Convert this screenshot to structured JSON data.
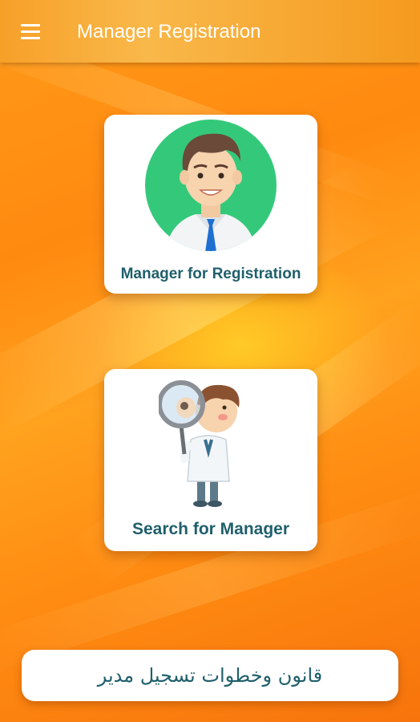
{
  "app_bar": {
    "title": "Manager Registration",
    "menu_icon": "hamburger-menu-icon"
  },
  "cards": {
    "register": {
      "label": "Manager for Registration",
      "image": "manager-avatar-icon"
    },
    "search": {
      "label": "Search for Manager",
      "image": "magnifier-doctor-icon"
    }
  },
  "bottom_button": {
    "label": "قانون وخطوات تسجيل مدير"
  },
  "colors": {
    "background": "#ff9a1a",
    "app_bar": "#f7a028",
    "card_text": "#1f5f6b",
    "avatar_circle": "#34c97a"
  }
}
